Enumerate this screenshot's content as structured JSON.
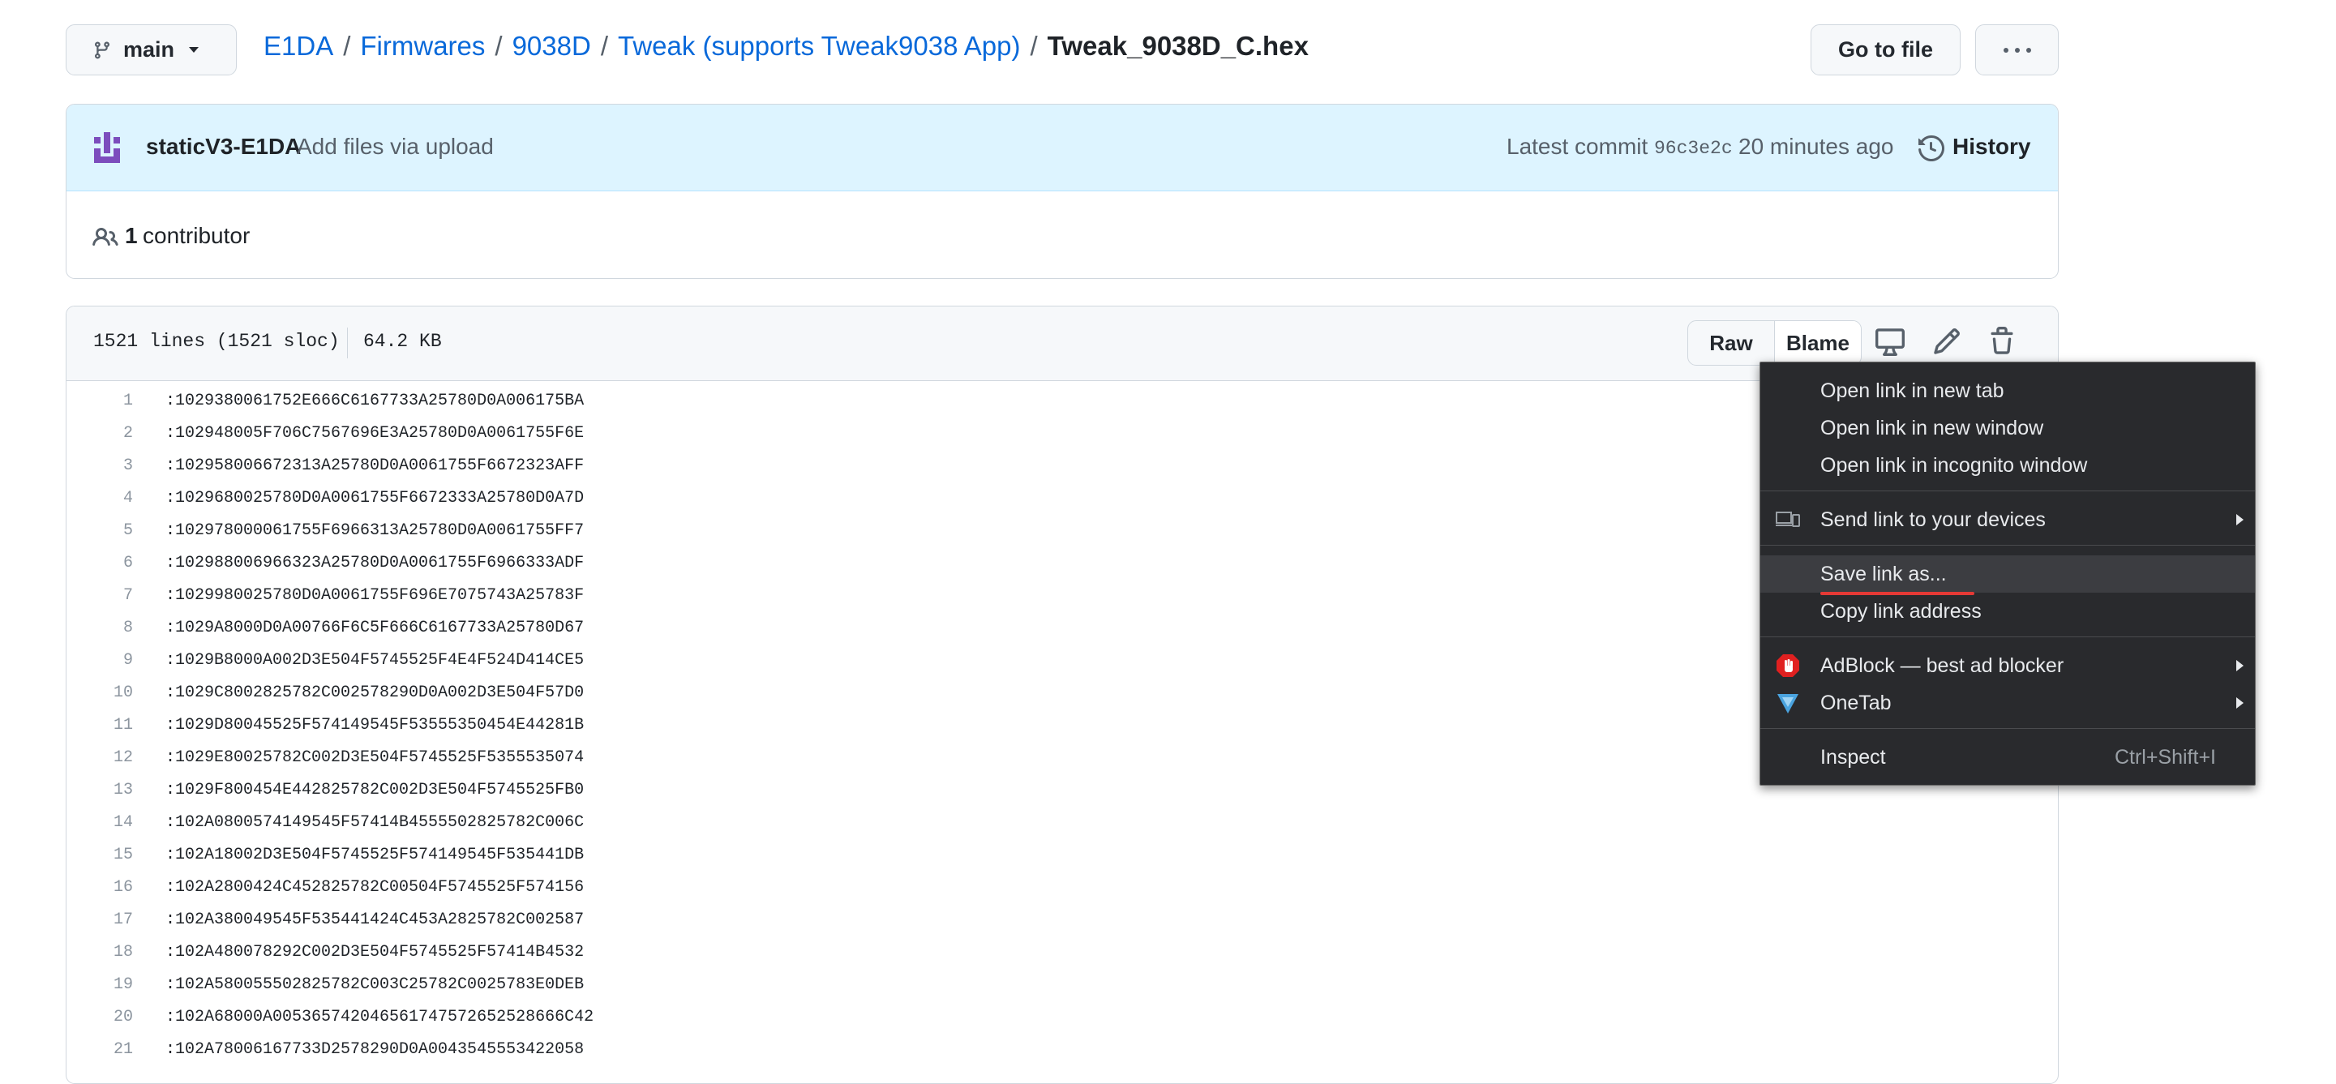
{
  "branch": {
    "label": "main"
  },
  "breadcrumb": {
    "items": [
      "E1DA",
      "Firmwares",
      "9038D",
      "Tweak (supports Tweak9038 App)"
    ],
    "current": "Tweak_9038D_C.hex",
    "separator": "/"
  },
  "header_buttons": {
    "goto": "Go to file",
    "more": "more-options-icon"
  },
  "commit": {
    "author": "staticV3-E1DA",
    "message": "Add files via upload",
    "latest_label": "Latest commit",
    "sha": "96c3e2c",
    "time": "20 minutes ago",
    "history_label": "History"
  },
  "contributors": {
    "count": "1",
    "label": "contributor"
  },
  "file": {
    "lines_info": "1521 lines (1521 sloc)",
    "size": "64.2 KB",
    "raw_label": "Raw",
    "blame_label": "Blame",
    "lines": [
      {
        "n": "1",
        "text": ":1029380061752E666C6167733A25780D0A006175BA"
      },
      {
        "n": "2",
        "text": ":102948005F706C7567696E3A25780D0A0061755F6E"
      },
      {
        "n": "3",
        "text": ":102958006672313A25780D0A0061755F6672323AFF"
      },
      {
        "n": "4",
        "text": ":1029680025780D0A0061755F6672333A25780D0A7D"
      },
      {
        "n": "5",
        "text": ":102978000061755F6966313A25780D0A0061755FF7"
      },
      {
        "n": "6",
        "text": ":102988006966323A25780D0A0061755F6966333ADF"
      },
      {
        "n": "7",
        "text": ":1029980025780D0A0061755F696E7075743A25783F"
      },
      {
        "n": "8",
        "text": ":1029A8000D0A00766F6C5F666C6167733A25780D67"
      },
      {
        "n": "9",
        "text": ":1029B8000A002D3E504F5745525F4E4F524D414CE5"
      },
      {
        "n": "10",
        "text": ":1029C8002825782C002578290D0A002D3E504F57D0"
      },
      {
        "n": "11",
        "text": ":1029D80045525F574149545F53555350454E44281B"
      },
      {
        "n": "12",
        "text": ":1029E80025782C002D3E504F5745525F5355535074"
      },
      {
        "n": "13",
        "text": ":1029F800454E442825782C002D3E504F5745525FB0"
      },
      {
        "n": "14",
        "text": ":102A0800574149545F57414B4555502825782C006C"
      },
      {
        "n": "15",
        "text": ":102A18002D3E504F5745525F574149545F535441DB"
      },
      {
        "n": "16",
        "text": ":102A2800424C452825782C00504F5745525F574156"
      },
      {
        "n": "17",
        "text": ":102A380049545F535441424C453A2825782C002587"
      },
      {
        "n": "18",
        "text": ":102A480078292C002D3E504F5745525F57414B4532"
      },
      {
        "n": "19",
        "text": ":102A580055502825782C003C25782C0025783E0DEB"
      },
      {
        "n": "20",
        "text": ":102A68000A005365742046561747572652528666C42"
      },
      {
        "n": "21",
        "text": ":102A78006167733D2578290D0A0043545553422058"
      }
    ]
  },
  "context_menu": {
    "items": [
      {
        "label": "Open link in new tab"
      },
      {
        "label": "Open link in new window"
      },
      {
        "label": "Open link in incognito window"
      },
      {
        "label": "Send link to your devices"
      },
      {
        "label": "Save link as..."
      },
      {
        "label": "Copy link address"
      },
      {
        "label": "AdBlock — best ad blocker"
      },
      {
        "label": "OneTab"
      },
      {
        "label": "Inspect",
        "shortcut": "Ctrl+Shift+I"
      }
    ]
  }
}
